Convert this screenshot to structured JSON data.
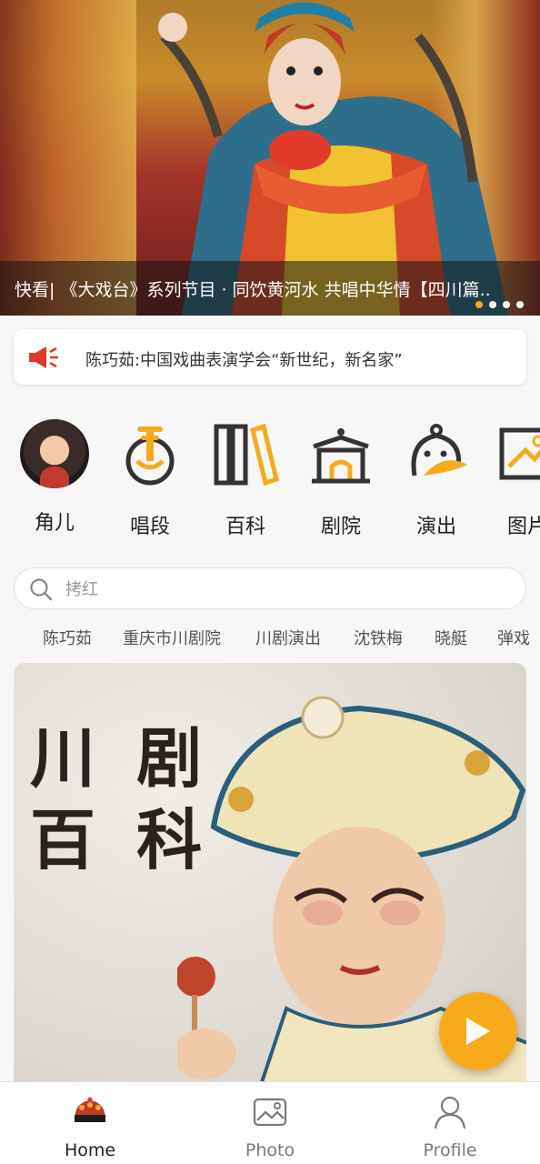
{
  "banner": {
    "caption": "快看| 《大戏台》系列节目 · 同饮黄河水 共唱中华情【四川篇..",
    "slide_count": 4,
    "active_slide": 1
  },
  "notice": {
    "text": "陈巧茹:中国戏曲表演学会“新世纪，新名家”",
    "icon": "speaker-icon"
  },
  "categories": [
    {
      "label": "角儿",
      "icon": "performer-avatar"
    },
    {
      "label": "唱段",
      "icon": "music-instrument-icon"
    },
    {
      "label": "百科",
      "icon": "books-icon"
    },
    {
      "label": "剧院",
      "icon": "theater-icon"
    },
    {
      "label": "演出",
      "icon": "performance-icon"
    },
    {
      "label": "图片",
      "icon": "picture-icon"
    }
  ],
  "search": {
    "placeholder": "拷红",
    "icon": "search-icon"
  },
  "hot_tags": [
    "陈巧茹",
    "重庆市川剧院",
    "川剧演出",
    "沈铁梅",
    "晓艇",
    "弹戏"
  ],
  "feature": {
    "title_line1": "川 剧",
    "title_line2": "百 科"
  },
  "fab": {
    "icon": "play-icon"
  },
  "tabbar": [
    {
      "label": "Home",
      "icon": "opera-headdress-icon",
      "active": true
    },
    {
      "label": "Photo",
      "icon": "photo-icon",
      "active": false
    },
    {
      "label": "Profile",
      "icon": "person-icon",
      "active": false
    }
  ],
  "colors": {
    "accent": "#f6aa1c",
    "speaker_red": "#e2372b",
    "icon_dark": "#333333"
  }
}
